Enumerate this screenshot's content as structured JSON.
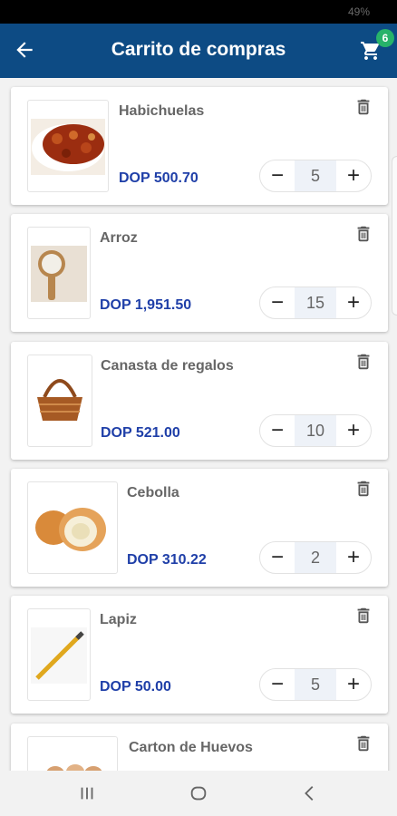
{
  "status": {
    "battery": "49%"
  },
  "header": {
    "title": "Carrito de compras",
    "cart_count": "6"
  },
  "items": [
    {
      "name": "Habichuelas",
      "price": "DOP 500.70",
      "qty": "5"
    },
    {
      "name": "Arroz",
      "price": "DOP 1,951.50",
      "qty": "15"
    },
    {
      "name": "Canasta de regalos",
      "price": "DOP 521.00",
      "qty": "10"
    },
    {
      "name": "Cebolla",
      "price": "DOP 310.22",
      "qty": "2"
    },
    {
      "name": "Lapiz",
      "price": "DOP 50.00",
      "qty": "5"
    },
    {
      "name": "Carton de Huevos",
      "price": "",
      "qty": ""
    }
  ],
  "stepper": {
    "minus": "−",
    "plus": "+"
  },
  "icons": {
    "back": "arrow-left-icon",
    "cart": "shopping-cart-icon",
    "trash": "trash-icon",
    "nav": [
      "recent-apps-icon",
      "home-icon",
      "back-nav-icon"
    ]
  },
  "colors": {
    "appbar": "#0d4b84",
    "price": "#1f3fa8",
    "badge": "#27b36a"
  }
}
